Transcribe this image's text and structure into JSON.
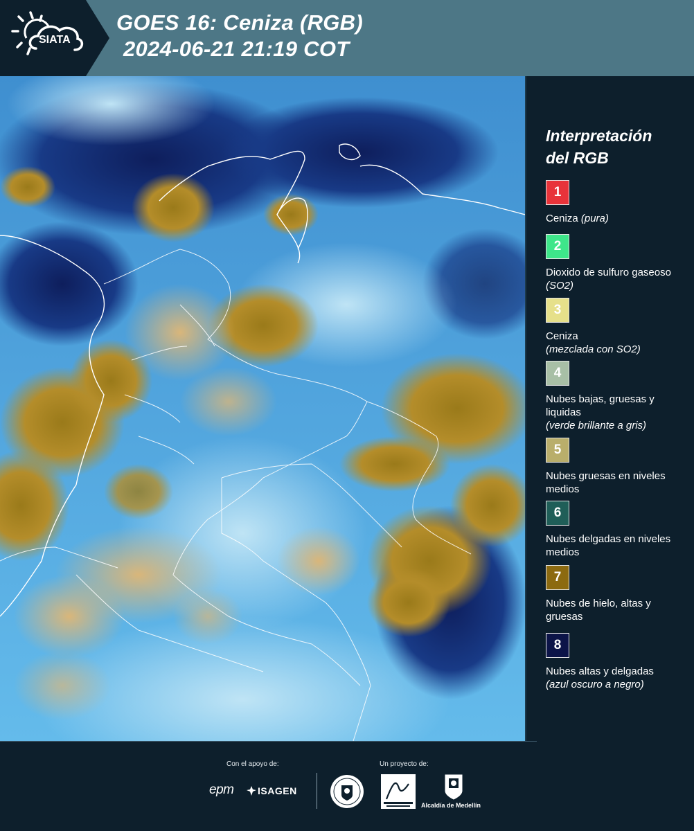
{
  "header": {
    "logo_text": "SIATA",
    "title_line1": "GOES 16: Ceniza (RGB)",
    "title_line2": "2024-06-21 21:19 COT",
    "background_color": "#4d7786"
  },
  "map": {
    "description_icon": "satellite-map-image"
  },
  "legend": {
    "title_line1": "Interpretación",
    "title_line2": "del RGB",
    "items": [
      {
        "number": "1",
        "label": "Ceniza",
        "label_italic": "(pura)",
        "color": "#e8333a"
      },
      {
        "number": "2",
        "label": "Dioxido de sulfuro gaseoso",
        "label_italic": "(SO2)",
        "color": "#3ee68a"
      },
      {
        "number": "3",
        "label": "Ceniza",
        "label_italic": "(mezclada con SO2)",
        "color": "#e6e08a"
      },
      {
        "number": "4",
        "label": "Nubes bajas, gruesas y liquidas",
        "label_italic": "(verde brillante a gris)",
        "color": "#a8bfa6"
      },
      {
        "number": "5",
        "label": "Nubes gruesas en niveles medios",
        "label_italic": "",
        "color": "#b9ae6b"
      },
      {
        "number": "6",
        "label": "Nubes delgadas en niveles medios",
        "label_italic": "",
        "color": "#1f5e58"
      },
      {
        "number": "7",
        "label": "Nubes de hielo, altas y gruesas",
        "label_italic": "",
        "color": "#8c6a10"
      },
      {
        "number": "8",
        "label": "Nubes altas y delgadas",
        "label_italic": "(azul oscuro a negro)",
        "color": "#0c1448"
      }
    ]
  },
  "footer": {
    "support_label": "Con el apoyo de:",
    "project_label": "Un proyecto de:",
    "epm_text": "epm",
    "isagen_text": "ISAGEN",
    "alcaldia_text": "Alcaldía de Medellín"
  }
}
